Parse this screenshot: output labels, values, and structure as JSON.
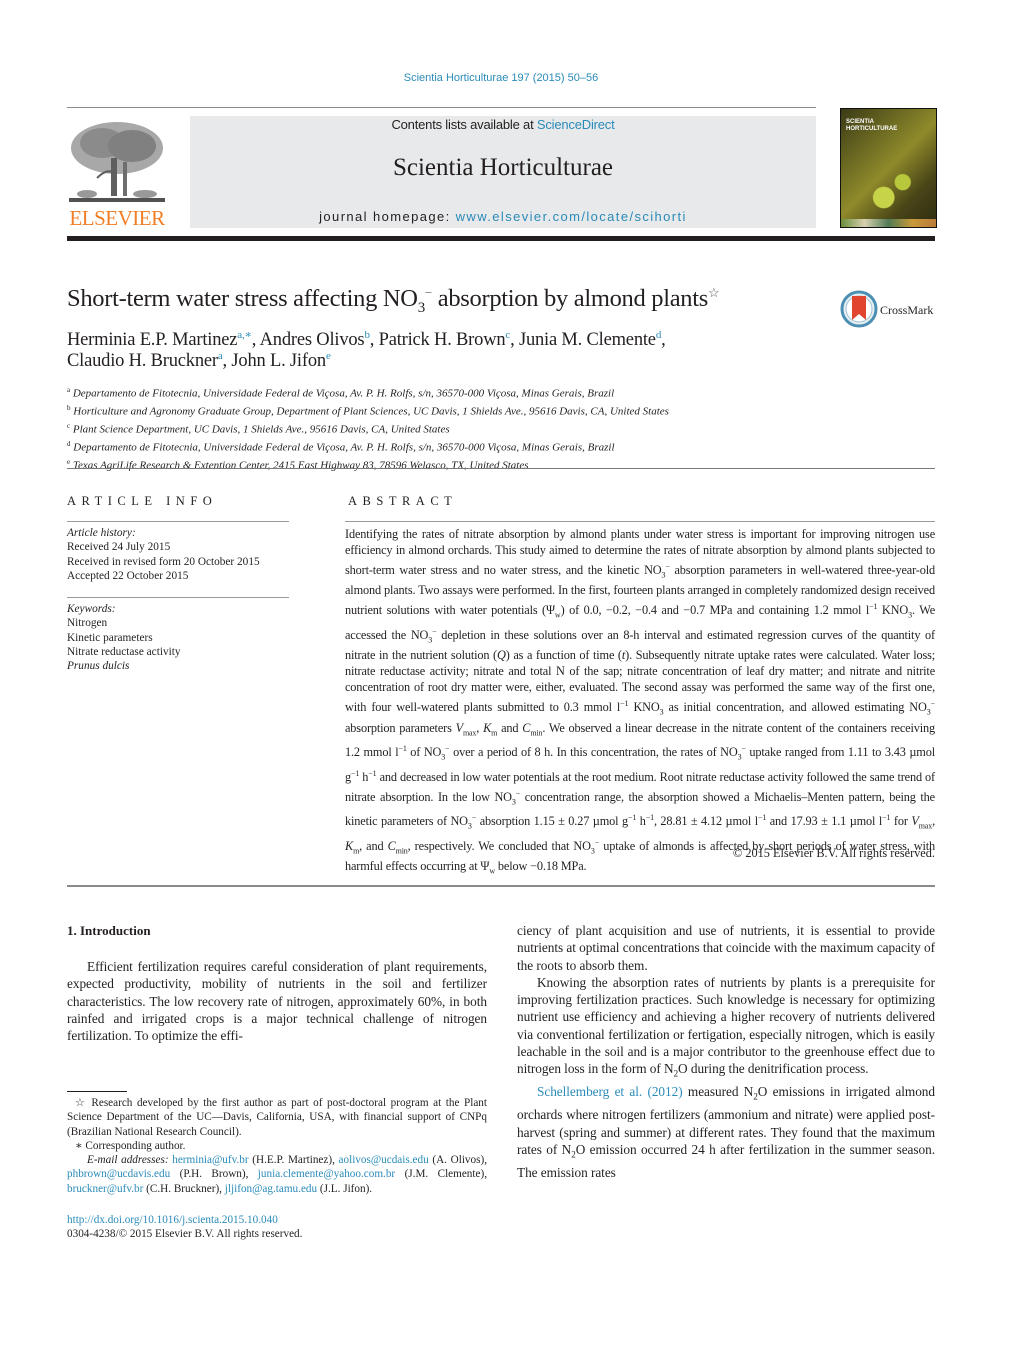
{
  "header": {
    "journal_reference": "Scientia Horticulturae 197 (2015) 50–56",
    "contents_prefix": "Contents lists available at ",
    "contents_link": "ScienceDirect",
    "journal_title": "Scientia Horticulturae",
    "homepage_prefix": "journal homepage: ",
    "homepage_link": "www.elsevier.com/locate/scihorti",
    "publisher_logo_text": "ELSEVIER",
    "cover_title_line1": "SCIENTIA",
    "cover_title_line2": "HORTICULTURAE",
    "brand_color": "#f07e26",
    "link_color": "#2a8bb8"
  },
  "article": {
    "title_part1": "Short-term water stress affecting NO",
    "title_sub": "3",
    "title_sup": "−",
    "title_part2": " absorption by almond plants",
    "title_note_mark": "☆",
    "crossmark_label": "CrossMark",
    "authors": [
      {
        "name": "Herminia E.P. Martinez",
        "aff": "a,∗"
      },
      {
        "name": "Andres Olivos",
        "aff": "b"
      },
      {
        "name": "Patrick H. Brown",
        "aff": "c"
      },
      {
        "name": "Junia M. Clemente",
        "aff": "d"
      },
      {
        "name": "Claudio H. Bruckner",
        "aff": "a"
      },
      {
        "name": "John L. Jifon",
        "aff": "e"
      }
    ],
    "affiliations": [
      {
        "mark": "a",
        "text": "Departamento de Fitotecnia, Universidade Federal de Viçosa, Av. P. H. Rolfs, s/n, 36570-000 Viçosa, Minas Gerais, Brazil"
      },
      {
        "mark": "b",
        "text": "Horticulture and Agronomy Graduate Group, Department of Plant Sciences, UC Davis, 1 Shields Ave., 95616 Davis, CA, United States"
      },
      {
        "mark": "c",
        "text": "Plant Science Department, UC Davis, 1 Shields Ave., 95616 Davis, CA, United States"
      },
      {
        "mark": "d",
        "text": "Departamento de Fitotecnia, Universidade Federal de Viçosa, Av. P. H. Rolfs, s/n, 36570-000 Viçosa, Minas Gerais, Brazil"
      },
      {
        "mark": "e",
        "text": "Texas AgriLife Research & Extention Center, 2415 East Highway 83, 78596 Welasco, TX, United States"
      }
    ]
  },
  "article_info": {
    "label": "ARTICLE INFO",
    "history_label": "Article history:",
    "received": "Received 24 July 2015",
    "revised": "Received in revised form 20 October 2015",
    "accepted": "Accepted 22 October 2015",
    "keywords_label": "Keywords:",
    "keywords": [
      "Nitrogen",
      "Kinetic parameters",
      "Nitrate reductase activity",
      "Prunus dulcis"
    ]
  },
  "abstract": {
    "label": "ABSTRACT",
    "segments": {
      "s1": "Identifying the rates of nitrate absorption by almond plants under water stress is important for improving nitrogen use efficiency in almond orchards. This study aimed to determine the rates of nitrate absorption by almond plants subjected to short-term water stress and no water stress, and the kinetic NO",
      "s2": " absorption parameters in well-watered three-year-old almond plants. Two assays were performed. In the first, fourteen plants arranged in completely randomized design received nutrient solutions with water potentials (Ψ",
      "s3": ") of 0.0, −0.2, −0.4 and −0.7 MPa and containing 1.2 mmol l",
      "s4": " KNO",
      "s5": ". We accessed the NO",
      "s6": " depletion in these solutions over an 8-h interval and estimated regression curves of the quantity of nitrate in the nutrient solution (",
      "s7": ") as a function of time (",
      "s8": "). Subsequently nitrate uptake rates were calculated. Water loss; nitrate reductase activity; nitrate and total N of the sap; nitrate concentration of leaf dry matter; and nitrate and nitrite concentration of root dry matter were, either, evaluated. The second assay was performed the same way of the first one, with four well-watered plants submitted to 0.3 mmol l",
      "s9": " KNO",
      "s10": " as initial concentration, and allowed estimating NO",
      "s11": " absorption parameters ",
      "s12": " and ",
      "s13": ". We observed a linear decrease in the nitrate content of the containers receiving 1.2 mmol l",
      "s14": " of NO",
      "s15": " over a period of 8 h. In this concentration, the rates of NO",
      "s16": " uptake ranged from 1.11 to 3.43 µmol g",
      "s17": " h",
      "s18": " and decreased in low water potentials at the root medium. Root nitrate reductase activity followed the same trend of nitrate absorption. In the low NO",
      "s19": " concentration range, the absorption showed a Michaelis–Menten pattern, being the kinetic parameters of NO",
      "s20": " absorption 1.15 ± 0.27 µmol g",
      "s21": " h",
      "s22": ", 28.81 ± 4.12 µmol l",
      "s23": " and 17.93 ± 1.1 µmol l",
      "s24": " for ",
      "s25": ", and ",
      "s26": ", respectively. We concluded that NO",
      "s27": " uptake of almonds is affected by short periods of water stress, with harmful effects occurring at Ψ",
      "s28": " below −0.18 MPa."
    },
    "sym": {
      "sub3": "3",
      "minus": "−",
      "minus1": "−1",
      "w": "w",
      "Q": "Q",
      "t": "t",
      "V": "V",
      "max": "max",
      "K": "K",
      "m": "m",
      "C": "C",
      "min": "min",
      "comma": ", "
    },
    "copyright": "© 2015 Elsevier B.V. All rights reserved."
  },
  "introduction": {
    "heading": "1.  Introduction",
    "left_para": "Efficient fertilization requires careful consideration of plant requirements, expected productivity, mobility of nutrients in the soil and fertilizer characteristics. The low recovery rate of nitrogen, approximately 60%, in both rainfed and irrigated crops is a major technical challenge of nitrogen fertilization. To optimize the effi-",
    "right_cont": "ciency of plant acquisition and use of nutrients, it is essential to provide nutrients at optimal concentrations that coincide with the maximum capacity of the roots to absorb them.",
    "right_para2_a": "Knowing the absorption rates of nutrients by plants is a prerequisite for improving fertilization practices. Such knowledge is necessary for optimizing nutrient use efficiency and achieving a higher recovery of nutrients delivered via conventional fertilization or fertigation, especially nitrogen, which is easily leachable in the soil and is a major contributor to the greenhouse effect due to nitrogen loss in the form of N",
    "right_para2_b": "O during the denitrification process.",
    "right_para3_link": "Schellemberg et al. (2012)",
    "right_para3_a": " measured N",
    "right_para3_b": "O emissions in irrigated almond orchards where nitrogen fertilizers (ammonium and nitrate) were applied post-harvest (spring and summer) at different rates. They found that the maximum rates of N",
    "right_para3_c": "O emission occurred 24 h after fertilization in the summer season. The emission rates",
    "sub2": "2"
  },
  "footnotes": {
    "star_mark": "☆",
    "star_text": " Research developed by the first author as part of post-doctoral program at the Plant Science Department of the UC—Davis, California, USA, with financial support of CNPq (Brazilian National Research Council).",
    "corr_mark": "∗",
    "corr_text": " Corresponding author.",
    "email_label": "E-mail addresses: ",
    "emails": [
      {
        "addr": "herminia@ufv.br",
        "who": " (H.E.P. Martinez), "
      },
      {
        "addr": "aolivos@ucdais.edu",
        "who": " (A. Olivos), "
      },
      {
        "addr": "phbrown@ucdavis.edu",
        "who": " (P.H. Brown), "
      },
      {
        "addr": "junia.clemente@yahoo.com.br",
        "who": " (J.M. Clemente), "
      },
      {
        "addr": "bruckner@ufv.br",
        "who": " (C.H. Bruckner), "
      },
      {
        "addr": "jljifon@ag.tamu.edu",
        "who": " (J.L. Jifon)."
      }
    ],
    "doi": "http://dx.doi.org/10.1016/j.scienta.2015.10.040",
    "issn_line": "0304-4238/© 2015 Elsevier B.V. All rights reserved."
  }
}
